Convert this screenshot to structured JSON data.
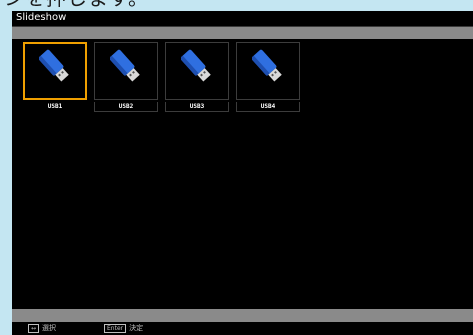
{
  "caption": "ンを押します。",
  "window": {
    "title": "Slideshow"
  },
  "devices": [
    {
      "label": "USB1",
      "selected": true,
      "icon": "usb-drive-icon"
    },
    {
      "label": "USB2",
      "selected": false,
      "icon": "usb-drive-icon"
    },
    {
      "label": "USB3",
      "selected": false,
      "icon": "usb-drive-icon"
    },
    {
      "label": "USB4",
      "selected": false,
      "icon": "usb-drive-icon"
    }
  ],
  "footer": {
    "hint1": {
      "key": "↔",
      "text": "選択"
    },
    "hint2": {
      "key": "Enter",
      "text": "決定"
    }
  },
  "colors": {
    "selection": "#f0a000",
    "usb_body": "#2f6fe0",
    "usb_plug": "#d9d9d9",
    "bar": "#8a8a8a"
  }
}
